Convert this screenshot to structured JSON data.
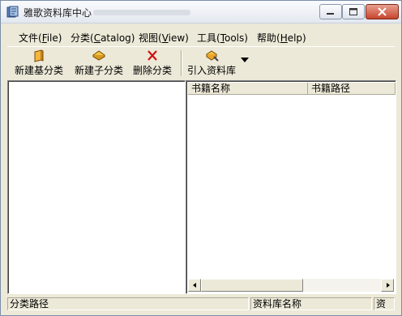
{
  "window": {
    "title": "雅歌资料库中心"
  },
  "menu": [
    {
      "label": "文件(",
      "key": "F",
      "tail": "ile)"
    },
    {
      "label": "分类(",
      "key": "C",
      "tail": "atalog)"
    },
    {
      "label": "视图(",
      "key": "V",
      "tail": "iew)"
    },
    {
      "label": "工具(",
      "key": "T",
      "tail": "ools)"
    },
    {
      "label": "帮助(",
      "key": "H",
      "tail": "elp)"
    }
  ],
  "toolbar": {
    "new_base_category": "新建基分类",
    "new_sub_category": "新建子分类",
    "delete_category": "删除分类",
    "import_library": "引入资料库"
  },
  "table": {
    "columns": [
      "书籍名称",
      "书籍路径"
    ]
  },
  "status": {
    "category_path": "分类路径",
    "library_name": "资料库名称",
    "extra": "资"
  },
  "colors": {
    "accent": "#ece9d8",
    "close": "#c7442c"
  }
}
